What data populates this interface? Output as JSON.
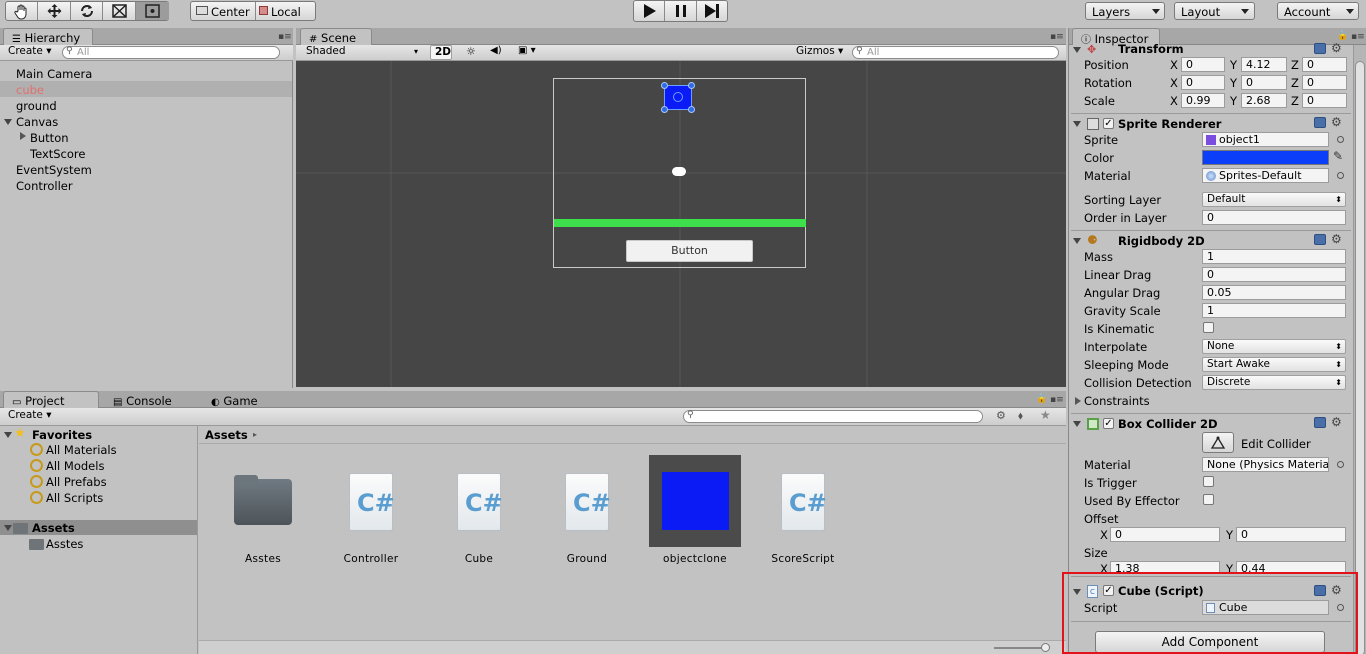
{
  "toolbar": {
    "pivot_center": "Center",
    "pivot_local": "Local",
    "layers": "Layers",
    "layout": "Layout",
    "account": "Account"
  },
  "hierarchy": {
    "tab": "Hierarchy",
    "create": "Create",
    "search_placeholder": "All",
    "items": [
      {
        "label": "Main Camera",
        "selected": false
      },
      {
        "label": "cube",
        "selected": true
      },
      {
        "label": "ground",
        "selected": false
      },
      {
        "label": "Canvas",
        "selected": false
      },
      {
        "label": "Button",
        "selected": false
      },
      {
        "label": "TextScore",
        "selected": false
      },
      {
        "label": "EventSystem",
        "selected": false
      },
      {
        "label": "Controller",
        "selected": false
      }
    ]
  },
  "scene": {
    "tab": "Scene",
    "shading": "Shaded",
    "mode_2d": "2D",
    "gizmos": "Gizmos",
    "search_placeholder": "All",
    "button_text": "Button",
    "colors": {
      "background": "#464646",
      "ground": "#3de04a",
      "cube": "#0a1bf5"
    }
  },
  "project": {
    "tabs": [
      "Project",
      "Console",
      "Game"
    ],
    "create": "Create",
    "breadcrumb": "Assets",
    "favorites_label": "Favorites",
    "favorites": [
      "All Materials",
      "All Models",
      "All Prefabs",
      "All Scripts"
    ],
    "assets_label": "Assets",
    "asset_folders": [
      "Asstes"
    ],
    "assets": [
      {
        "name": "Asstes",
        "icon": "folder-icon"
      },
      {
        "name": "Controller",
        "icon": "csharp-script-icon"
      },
      {
        "name": "Cube",
        "icon": "csharp-script-icon"
      },
      {
        "name": "Ground",
        "icon": "csharp-script-icon"
      },
      {
        "name": "objectclone",
        "icon": "prefab-thumbnail"
      },
      {
        "name": "ScoreScript",
        "icon": "csharp-script-icon"
      }
    ]
  },
  "inspector": {
    "tab": "Inspector",
    "transform": {
      "title": "Transform",
      "position_label": "Position",
      "rotation_label": "Rotation",
      "scale_label": "Scale",
      "x_label": "X",
      "y_label": "Y",
      "z_label": "Z",
      "position": [
        "0",
        "4.12",
        "0"
      ],
      "rotation": [
        "0",
        "0",
        "0"
      ],
      "scale": [
        "0.99",
        "2.68",
        "0"
      ]
    },
    "sprite_renderer": {
      "title": "Sprite Renderer",
      "sprite_label": "Sprite",
      "sprite": "object1",
      "color_label": "Color",
      "color": "#0a3ef8",
      "material_label": "Material",
      "material": "Sprites-Default",
      "sorting_layer_label": "Sorting Layer",
      "sorting_layer": "Default",
      "order_label": "Order in Layer",
      "order": "0"
    },
    "rigidbody": {
      "title": "Rigidbody 2D",
      "mass_label": "Mass",
      "mass": "1",
      "linear_drag_label": "Linear Drag",
      "linear_drag": "0",
      "angular_drag_label": "Angular Drag",
      "angular_drag": "0.05",
      "gravity_label": "Gravity Scale",
      "gravity": "1",
      "kinematic_label": "Is Kinematic",
      "interpolate_label": "Interpolate",
      "interpolate": "None",
      "sleeping_label": "Sleeping Mode",
      "sleeping": "Start Awake",
      "collision_label": "Collision Detection",
      "collision": "Discrete",
      "constraints_label": "Constraints"
    },
    "box_collider": {
      "title": "Box Collider 2D",
      "edit_label": "Edit Collider",
      "material_label": "Material",
      "material": "None (Physics Materia",
      "trigger_label": "Is Trigger",
      "effector_label": "Used By Effector",
      "offset_label": "Offset",
      "offset": [
        "0",
        "0"
      ],
      "size_label": "Size",
      "size": [
        "1.38",
        "0.44"
      ],
      "x_label": "X",
      "y_label": "Y"
    },
    "cube_script": {
      "title": "Cube (Script)",
      "script_label": "Script",
      "script": "Cube"
    },
    "add_component": "Add Component",
    "highlight_color": "#e0141a"
  }
}
